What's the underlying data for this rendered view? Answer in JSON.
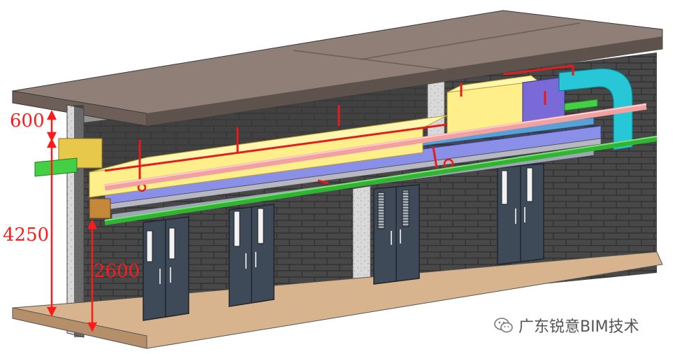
{
  "dimensions": {
    "top_clearance": "600",
    "total_height": "4250",
    "door_clearance": "2600"
  },
  "watermark": {
    "text": "广东锐意BIM技术",
    "icon": "wechat-icon"
  },
  "colors": {
    "dimension": "#ff1a1a",
    "duct_yellow": "#ffef8a",
    "pipe_red": "#e41c1c",
    "pipe_pink": "#f2a0a0",
    "pipe_green": "#2fb52f",
    "cable_tray_blue": "#7fa7e0",
    "duct_cyan": "#27c7d8",
    "brick_wall": "#4a4a4a",
    "door": "#3f4a58",
    "slab": "#9b8b82",
    "floor": "#d8b48e"
  },
  "elements": {
    "doors": 4,
    "columns": 2
  }
}
